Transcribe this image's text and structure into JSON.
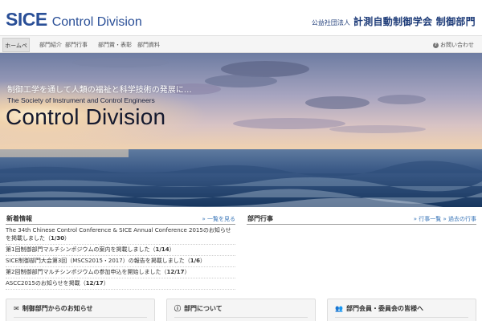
{
  "header": {
    "logo_sice": "SICE",
    "logo_division": "Control Division",
    "org_prefix": "公益社団法人",
    "org_name": "計測自動制御学会 制御部門"
  },
  "nav": {
    "items": [
      {
        "label": "ホームページ",
        "active": true
      },
      {
        "label": "部門紹介",
        "active": false
      },
      {
        "label": "部門行事",
        "active": false
      },
      {
        "label": "部門賞・表彰制度",
        "active": false
      },
      {
        "label": "部門資料",
        "active": false
      }
    ],
    "right_label": "お問い合わせ",
    "right_icon": "question-icon"
  },
  "hero": {
    "tagline_jp": "制御工学を通して人類の福祉と科学技術の発展に…",
    "society_en": "The Society of Instrument and Control Engineers",
    "title": "Control Division",
    "colors": {
      "sky_top": "#6f7ea3",
      "sky_mid": "#b5aec3",
      "horizon": "#f2cfae",
      "sea_top": "#42608a",
      "sea_bottom": "#1a3a66"
    }
  },
  "news": {
    "title": "新着情報",
    "more": "» 一覧を見る",
    "items": [
      {
        "text": "The 34th Chinese Control Conference & SICE Annual Conference 2015のお知らせを掲載しました",
        "date": "1/30"
      },
      {
        "text": "第1回制御部門マルチシンポジウムの案内を掲載しました",
        "date": "1/14"
      },
      {
        "text": "SICE制御部門大会第3回（MSCS2015・2017）の報告を掲載しました",
        "date": "1/6"
      },
      {
        "text": "第2回制御部門マルチシンポジウムの参加申込を開始しました",
        "date": "12/17"
      },
      {
        "text": "ASCC2015のお知らせを掲載",
        "date": "12/17"
      }
    ]
  },
  "events": {
    "title": "部門行事",
    "more": "» 行事一覧 » 過去の行事"
  },
  "boxes": [
    {
      "title": "制御部門からのお知らせ",
      "icon": "envelope-icon"
    },
    {
      "title": "部門について",
      "icon": "info-icon"
    },
    {
      "title": "部門会員・委員会の皆様へ",
      "icon": "users-icon"
    }
  ]
}
